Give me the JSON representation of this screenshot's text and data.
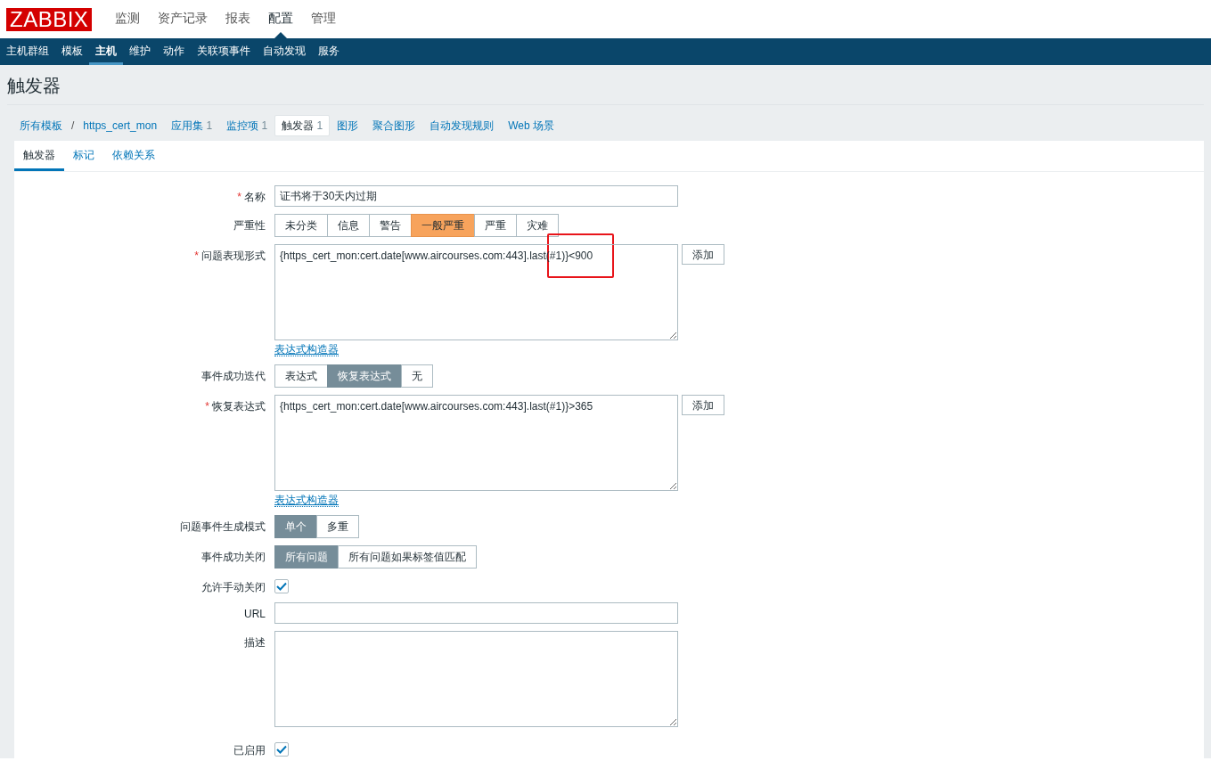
{
  "top_nav": [
    {
      "label": "监测",
      "selected": false
    },
    {
      "label": "资产记录",
      "selected": false
    },
    {
      "label": "报表",
      "selected": false
    },
    {
      "label": "配置",
      "selected": true
    },
    {
      "label": "管理",
      "selected": false
    }
  ],
  "logo": "ZABBIX",
  "sub_nav": [
    {
      "label": "主机群组",
      "selected": false
    },
    {
      "label": "模板",
      "selected": false
    },
    {
      "label": "主机",
      "selected": true
    },
    {
      "label": "维护",
      "selected": false
    },
    {
      "label": "动作",
      "selected": false
    },
    {
      "label": "关联项事件",
      "selected": false
    },
    {
      "label": "自动发现",
      "selected": false
    },
    {
      "label": "服务",
      "selected": false
    }
  ],
  "page_title": "触发器",
  "breadcrumbs": [
    {
      "label": "所有模板",
      "selected": false
    },
    {
      "label": "https_cert_mon",
      "selected": false
    },
    {
      "label": "应用集",
      "count": "1",
      "selected": false
    },
    {
      "label": "监控项",
      "count": "1",
      "selected": false
    },
    {
      "label": "触发器",
      "count": "1",
      "selected": true
    },
    {
      "label": "图形",
      "selected": false
    },
    {
      "label": "聚合图形",
      "selected": false
    },
    {
      "label": "自动发现规则",
      "selected": false
    },
    {
      "label": "Web 场景",
      "selected": false
    }
  ],
  "breadcrumb_separator": "/",
  "tabs": [
    {
      "label": "触发器",
      "selected": true
    },
    {
      "label": "标记",
      "selected": false
    },
    {
      "label": "依赖关系",
      "selected": false
    }
  ],
  "form": [
    {
      "kind": "text",
      "label": "名称",
      "required_mark": "*",
      "value": "证书将于30天内过期"
    },
    {
      "kind": "severity",
      "label": "严重性",
      "options": [
        {
          "label": "未分类",
          "selected": false
        },
        {
          "label": "信息",
          "selected": false
        },
        {
          "label": "警告",
          "selected": false
        },
        {
          "label": "一般严重",
          "selected": true
        },
        {
          "label": "严重",
          "selected": false
        },
        {
          "label": "灾难",
          "selected": false
        }
      ]
    },
    {
      "kind": "expression",
      "label": "问题表现形式",
      "required_mark": "*",
      "value": "{https_cert_mon:cert.date[www.aircourses.com:443].last(#1)}<900",
      "button": "添加",
      "link": "表达式构造器",
      "highlighted": true
    },
    {
      "kind": "segmented",
      "label": "事件成功迭代",
      "options": [
        {
          "label": "表达式",
          "selected": false
        },
        {
          "label": "恢复表达式",
          "selected": true
        },
        {
          "label": "无",
          "selected": false
        }
      ]
    },
    {
      "kind": "expression",
      "label": "恢复表达式",
      "required_mark": "*",
      "value": "{https_cert_mon:cert.date[www.aircourses.com:443].last(#1)}>365",
      "button": "添加",
      "link": "表达式构造器"
    },
    {
      "kind": "segmented",
      "label": "问题事件生成模式",
      "options": [
        {
          "label": "单个",
          "selected": true
        },
        {
          "label": "多重",
          "selected": false
        }
      ]
    },
    {
      "kind": "segmented",
      "label": "事件成功关闭",
      "options": [
        {
          "label": "所有问题",
          "selected": true
        },
        {
          "label": "所有问题如果标签值匹配",
          "selected": false
        }
      ]
    },
    {
      "kind": "checkbox",
      "label": "允许手动关闭",
      "checked": true
    },
    {
      "kind": "text",
      "label": "URL"
    },
    {
      "kind": "textarea",
      "label": "描述"
    },
    {
      "kind": "checkbox",
      "label": "已启用",
      "checked": true
    }
  ]
}
